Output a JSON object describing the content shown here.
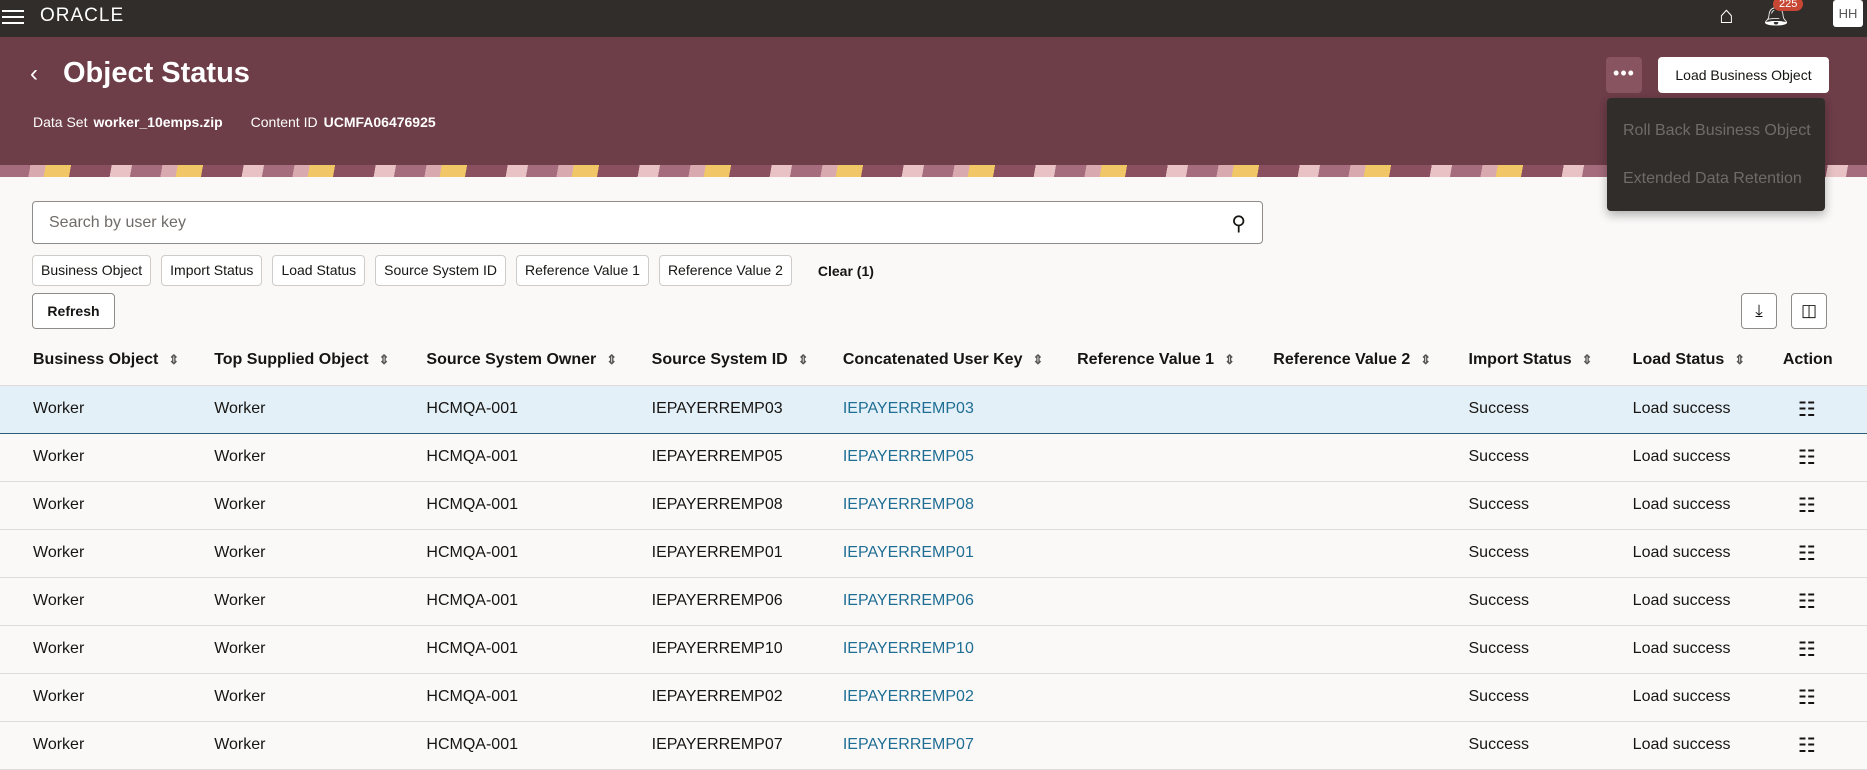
{
  "topbar": {
    "brand": "ORACLE",
    "notifications": "225",
    "user_initials": "HH"
  },
  "header": {
    "title": "Object Status",
    "data_set_label": "Data Set",
    "data_set": "worker_10emps.zip",
    "content_id_label": "Content ID",
    "content_id": "UCMFA06476925",
    "more_label": "•••",
    "load_button": "Load Business Object"
  },
  "menu": [
    "Roll Back Business Object",
    "Extended Data Retention"
  ],
  "search": {
    "placeholder": "Search by user key"
  },
  "filters": [
    "Business Object",
    "Import Status",
    "Load Status",
    "Source System ID",
    "Reference Value 1",
    "Reference Value 2"
  ],
  "clear_label": "Clear (1)",
  "refresh_label": "Refresh",
  "columns": [
    "Business Object",
    "Top Supplied Object",
    "Source System Owner",
    "Source System ID",
    "Concatenated User Key",
    "Reference Value 1",
    "Reference Value 2",
    "Import Status",
    "Load Status",
    "Action"
  ],
  "rows": [
    [
      "Worker",
      "Worker",
      "HCMQA-001",
      "IEPAYERREMP03",
      "IEPAYERREMP03",
      "",
      "",
      "Success",
      "Load success"
    ],
    [
      "Worker",
      "Worker",
      "HCMQA-001",
      "IEPAYERREMP05",
      "IEPAYERREMP05",
      "",
      "",
      "Success",
      "Load success"
    ],
    [
      "Worker",
      "Worker",
      "HCMQA-001",
      "IEPAYERREMP08",
      "IEPAYERREMP08",
      "",
      "",
      "Success",
      "Load success"
    ],
    [
      "Worker",
      "Worker",
      "HCMQA-001",
      "IEPAYERREMP01",
      "IEPAYERREMP01",
      "",
      "",
      "Success",
      "Load success"
    ],
    [
      "Worker",
      "Worker",
      "HCMQA-001",
      "IEPAYERREMP06",
      "IEPAYERREMP06",
      "",
      "",
      "Success",
      "Load success"
    ],
    [
      "Worker",
      "Worker",
      "HCMQA-001",
      "IEPAYERREMP10",
      "IEPAYERREMP10",
      "",
      "",
      "Success",
      "Load success"
    ],
    [
      "Worker",
      "Worker",
      "HCMQA-001",
      "IEPAYERREMP02",
      "IEPAYERREMP02",
      "",
      "",
      "Success",
      "Load success"
    ],
    [
      "Worker",
      "Worker",
      "HCMQA-001",
      "IEPAYERREMP07",
      "IEPAYERREMP07",
      "",
      "",
      "Success",
      "Load success"
    ]
  ]
}
